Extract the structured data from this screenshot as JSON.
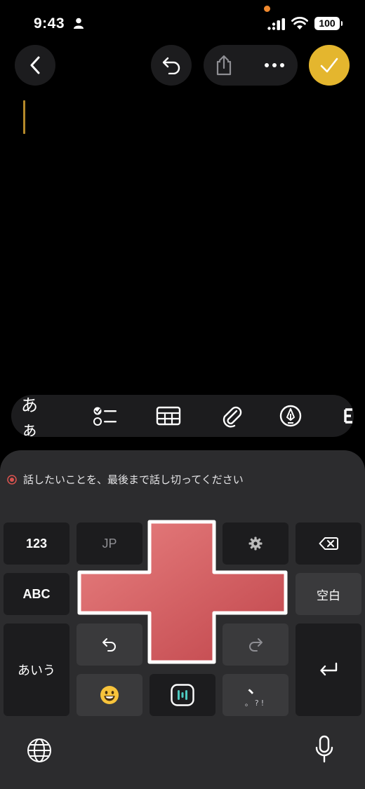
{
  "status_bar": {
    "time": "9:43",
    "battery": "100"
  },
  "toolbar": {
    "back_icon": "chevron-left-icon",
    "undo_icon": "undo-icon",
    "share_icon": "share-icon",
    "more_icon": "ellipsis-icon",
    "done_icon": "checkmark-icon",
    "done_color": "#e4b62e"
  },
  "format_bar": {
    "text_style_label": "あぁ",
    "checklist_icon": "checklist-icon",
    "table_icon": "table-icon",
    "attach_icon": "paperclip-icon",
    "markup_icon": "pen-circle-icon"
  },
  "keyboard": {
    "voice_hint": "話したいことを、最後まで話し切ってください",
    "keys": {
      "numbers": "123",
      "jp": "JP",
      "abc": "ABC",
      "space": "空白",
      "kana": "あいう",
      "punct_top": "、",
      "punct_bottom": "。?!"
    },
    "icons": {
      "settings": "gear-icon",
      "delete": "backspace-icon",
      "undo": "undo-icon",
      "redo": "redo-icon",
      "emoji": "emoji-icon",
      "voice": "voice-wave-icon",
      "enter": "return-icon",
      "globe": "globe-icon",
      "mic": "microphone-icon"
    }
  },
  "overlay": {
    "shape": "red-cross",
    "color": "#d55a5e"
  }
}
